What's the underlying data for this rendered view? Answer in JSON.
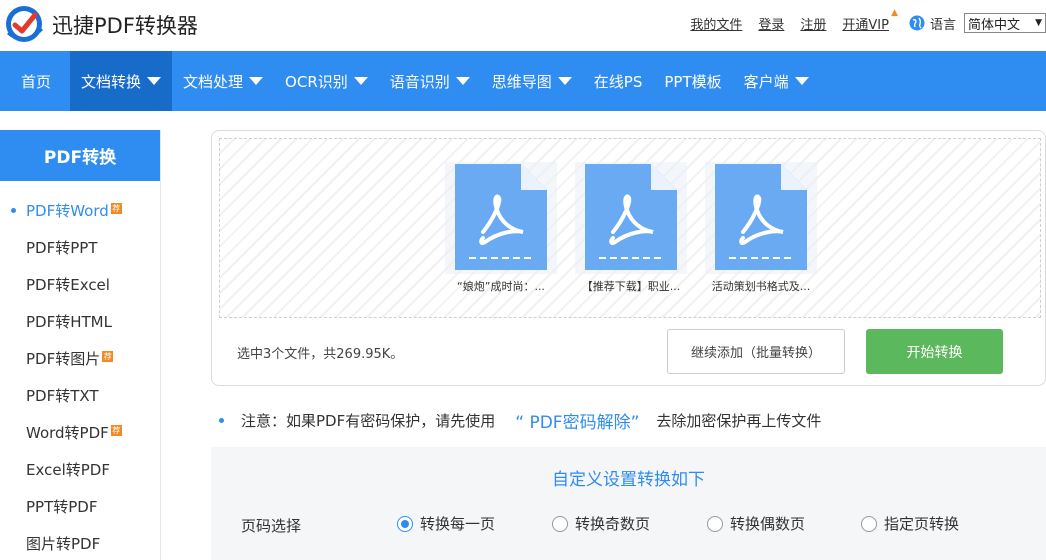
{
  "header": {
    "brand": "迅捷PDF转换器",
    "links": [
      "我的文件",
      "登录",
      "注册",
      "开通VIP"
    ],
    "language_label": "语言",
    "language_value": "简体中文"
  },
  "nav": {
    "items": [
      {
        "label": "首页",
        "has_caret": false
      },
      {
        "label": "文档转换",
        "has_caret": true,
        "active": true
      },
      {
        "label": "文档处理",
        "has_caret": true
      },
      {
        "label": "OCR识别",
        "has_caret": true
      },
      {
        "label": "语音识别",
        "has_caret": true
      },
      {
        "label": "思维导图",
        "has_caret": true
      },
      {
        "label": "在线PS",
        "has_caret": false
      },
      {
        "label": "PPT模板",
        "has_caret": false
      },
      {
        "label": "客户端",
        "has_caret": true
      }
    ]
  },
  "sidebar": {
    "title": "PDF转换",
    "items": [
      {
        "label": "PDF转Word",
        "badge": true,
        "active": true
      },
      {
        "label": "PDF转PPT"
      },
      {
        "label": "PDF转Excel"
      },
      {
        "label": "PDF转HTML"
      },
      {
        "label": "PDF转图片",
        "badge": true
      },
      {
        "label": "PDF转TXT"
      },
      {
        "label": "Word转PDF",
        "badge": true
      },
      {
        "label": "Excel转PDF"
      },
      {
        "label": "PPT转PDF"
      },
      {
        "label": "图片转PDF"
      }
    ]
  },
  "upload": {
    "files": [
      {
        "name": "“娘炮”成时尚：..."
      },
      {
        "name": "【推荐下载】职业..."
      },
      {
        "name": "活动策划书格式及..."
      }
    ],
    "status": "选中3个文件，共269.95K。",
    "add_button": "继续添加（批量转换）",
    "start_button": "开始转换"
  },
  "notice": {
    "prefix": "注意：如果PDF有密码保护，请先使用",
    "link": "“ PDF密码解除”",
    "suffix": "去除加密保护再上传文件"
  },
  "settings": {
    "title": "自定义设置转换如下",
    "page_label": "页码选择",
    "options": [
      "转换每一页",
      "转换奇数页",
      "转换偶数页",
      "指定页转换"
    ],
    "selected": "转换每一页"
  },
  "colors": {
    "primary": "#2f8cf0",
    "nav_active": "#176cc9",
    "start_button": "#5cb85c",
    "file_icon": "#6aaaf2",
    "badge": "#f08a24"
  }
}
